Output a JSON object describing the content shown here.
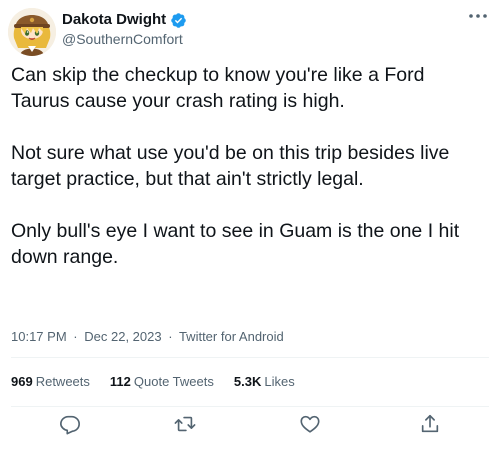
{
  "author": {
    "display_name": "Dakota Dwight",
    "handle": "@SouthernComfort",
    "verified": true,
    "avatar_icon": "anime-character-avatar"
  },
  "tweet": {
    "paragraphs": [
      "Can skip the checkup to know you're like a Ford Taurus cause your crash rating is high.",
      "Not sure what use you'd be on this trip besides live target practice, but that ain't strictly legal.",
      "Only bull's eye I want to see in Guam is the one I hit down range."
    ],
    "time": "10:17 PM",
    "date": "Dec 22, 2023",
    "separator": "·",
    "source": "Twitter for Android"
  },
  "stats": {
    "retweets_count": "969",
    "retweets_label": "Retweets",
    "quotes_count": "112",
    "quotes_label": "Quote Tweets",
    "likes_count": "5.3K",
    "likes_label": "Likes"
  },
  "colors": {
    "text": "#0f1419",
    "secondary": "#536471",
    "verified": "#1d9bf0",
    "divider": "#eff3f4"
  },
  "icons": {
    "more": "more-horizontal-icon",
    "reply": "reply-icon",
    "retweet": "retweet-icon",
    "like": "heart-icon",
    "share": "share-icon"
  }
}
